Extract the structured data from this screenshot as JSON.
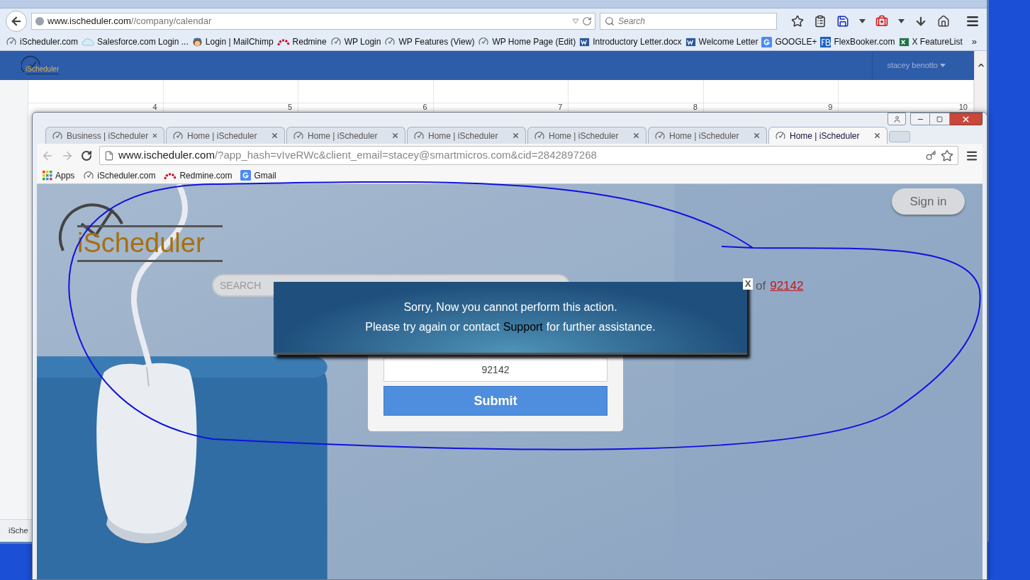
{
  "firefox": {
    "url_host": "www.ischeduler.com",
    "url_path": "//company/calendar",
    "search_placeholder": "Search",
    "bookmarks": [
      {
        "label": "iScheduler.com",
        "kind": "clock"
      },
      {
        "label": "Salesforce.com Login ...",
        "kind": "cloud"
      },
      {
        "label": "Login | MailChimp",
        "kind": "chimp"
      },
      {
        "label": "Redmine",
        "kind": "redmine"
      },
      {
        "label": "WP Login",
        "kind": "clock"
      },
      {
        "label": "WP Features (View)",
        "kind": "clock"
      },
      {
        "label": "WP Home Page (Edit)",
        "kind": "clock"
      },
      {
        "label": "Introductory Letter.docx",
        "kind": "word"
      },
      {
        "label": "Welcome Letter",
        "kind": "word"
      },
      {
        "label": "GOOGLE+",
        "kind": "google"
      },
      {
        "label": "FlexBooker.com",
        "kind": "fb"
      },
      {
        "label": "X FeatureList",
        "kind": "excel"
      }
    ],
    "bookmarks_overflow": "»",
    "logo": "iScheduler",
    "user_menu": "stacey benotto",
    "calendar_days": [
      "4",
      "5",
      "6",
      "7",
      "8",
      "9",
      "10"
    ],
    "status_text": "iSche"
  },
  "chrome": {
    "tabs": [
      {
        "title": "Business | iScheduler",
        "selected": false
      },
      {
        "title": "Home | iScheduler",
        "selected": false
      },
      {
        "title": "Home | iScheduler",
        "selected": false
      },
      {
        "title": "Home | iScheduler",
        "selected": false
      },
      {
        "title": "Home | iScheduler",
        "selected": false
      },
      {
        "title": "Home | iScheduler",
        "selected": false
      },
      {
        "title": "Home | iScheduler",
        "selected": true
      }
    ],
    "url_host": "www.ischeduler.com",
    "url_rest": "/?app_hash=vIveRWc&client_email=stacey@smartmicros.com&cid=2842897268",
    "bookmarks": [
      {
        "label": "Apps",
        "kind": "apps"
      },
      {
        "label": "iScheduler.com",
        "kind": "clock"
      },
      {
        "label": "Redmine.com",
        "kind": "redmine"
      },
      {
        "label": "Gmail",
        "kind": "google"
      }
    ],
    "page": {
      "logo": "iScheduler",
      "sign_in": "Sign in",
      "search_placeholder": "SEARCH",
      "radius_of": "of",
      "zip_link": "92142",
      "alert": {
        "line1": "Sorry, Now you cannot perform this action.",
        "line2_before": "Please try again or contact",
        "link": "Support",
        "line2_after": "for further assistance.",
        "close": "X"
      },
      "zip_value": "92142",
      "submit": "Submit"
    }
  }
}
